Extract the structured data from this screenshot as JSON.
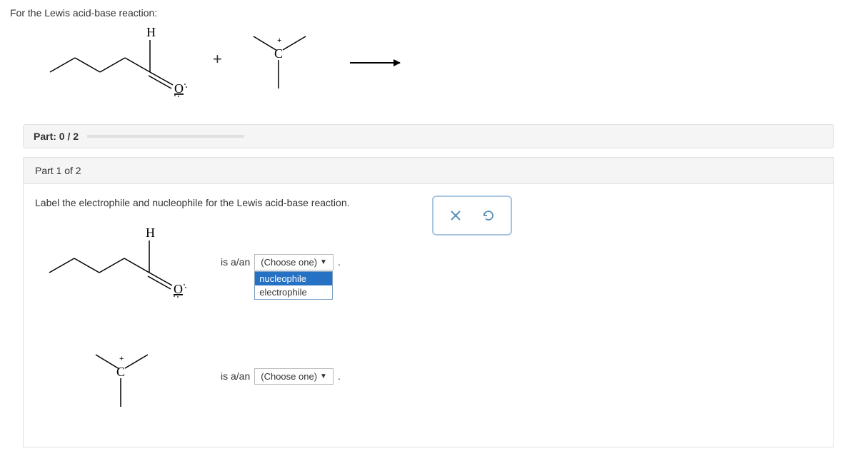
{
  "prompt": "For the Lewis acid-base reaction:",
  "plus": "+",
  "progress": {
    "label": "Part: 0 / 2"
  },
  "part": {
    "header": "Part 1 of 2",
    "instruction": "Label the electrophile and nucleophile for the Lewis acid-base reaction.",
    "is_an": "is a/an",
    "select_placeholder": "(Choose one)",
    "options": {
      "nucleophile": "nucleophile",
      "electrophile": "electrophile"
    },
    "period": "."
  },
  "atoms": {
    "H": "H",
    "O": "O",
    "C": "C",
    "plus_charge": "+"
  },
  "toolbar": {
    "close_title": "Clear",
    "reset_title": "Reset"
  }
}
